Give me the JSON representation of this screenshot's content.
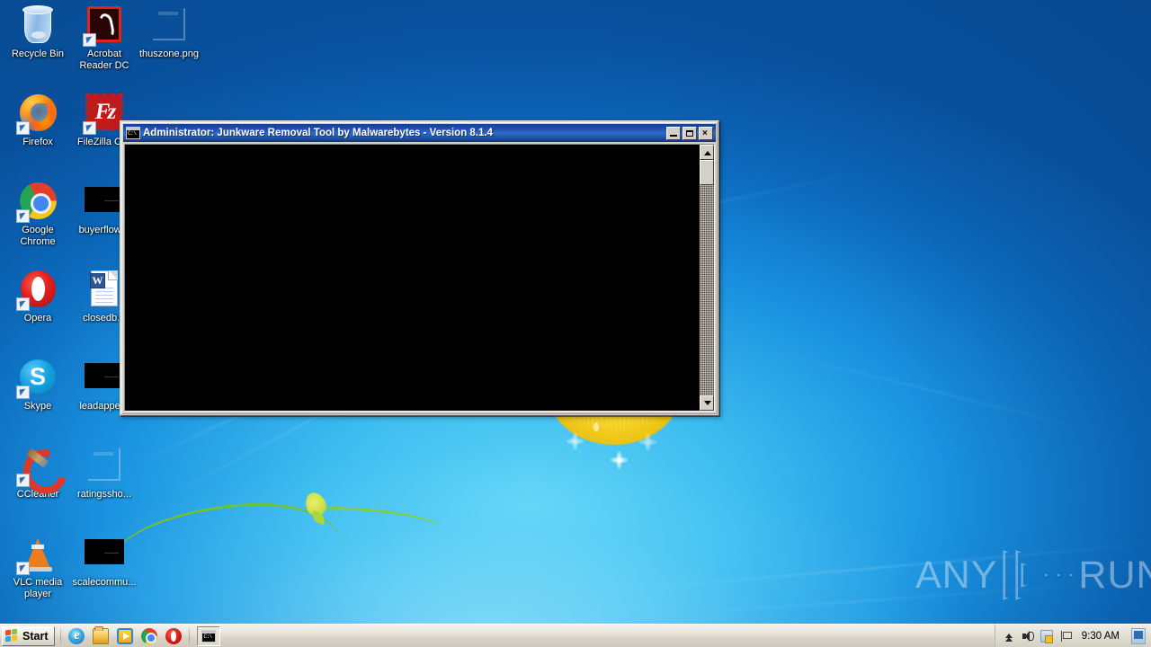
{
  "window": {
    "title": "Administrator:  Junkware Removal Tool by Malwarebytes - Version 8.1.4",
    "icon_name": "cmd-console-icon",
    "icon_text": "C:\\",
    "console_output": "",
    "minimize_label": "",
    "maximize_label": "",
    "close_label": "×"
  },
  "desktop": {
    "icons": [
      {
        "label": "Recycle Bin",
        "art": "recycle",
        "shortcut": false,
        "col": 0,
        "row": 0
      },
      {
        "label": "Acrobat\nReader DC",
        "art": "acrobat",
        "shortcut": true,
        "col": 1,
        "row": 0
      },
      {
        "label": "thuszone.png",
        "art": "ghost",
        "shortcut": false,
        "col": 2,
        "row": 0
      },
      {
        "label": "Firefox",
        "art": "firefox",
        "shortcut": true,
        "col": 0,
        "row": 1
      },
      {
        "label": "FileZilla Clie",
        "art": "filezilla",
        "shortcut": true,
        "col": 1,
        "row": 1
      },
      {
        "label": "Google\nChrome",
        "art": "chrome",
        "shortcut": true,
        "col": 0,
        "row": 2
      },
      {
        "label": "buyerflower",
        "art": "blackthumb",
        "shortcut": false,
        "col": 1,
        "row": 2
      },
      {
        "label": "Opera",
        "art": "opera",
        "shortcut": true,
        "col": 0,
        "row": 3
      },
      {
        "label": "closedb.rt",
        "art": "doc",
        "shortcut": false,
        "col": 1,
        "row": 3
      },
      {
        "label": "Skype",
        "art": "skype",
        "shortcut": true,
        "col": 0,
        "row": 4
      },
      {
        "label": "leadappear",
        "art": "blackthumb",
        "shortcut": false,
        "col": 1,
        "row": 4
      },
      {
        "label": "CCleaner",
        "art": "ccleaner",
        "shortcut": true,
        "col": 0,
        "row": 5
      },
      {
        "label": "ratingssho...",
        "art": "ghost",
        "shortcut": false,
        "col": 1,
        "row": 5
      },
      {
        "label": "VLC media\nplayer",
        "art": "vlc",
        "shortcut": true,
        "col": 0,
        "row": 6
      },
      {
        "label": "scalecommu...",
        "art": "blackthumb",
        "shortcut": false,
        "col": 1,
        "row": 6
      }
    ]
  },
  "taskbar": {
    "start_label": "Start",
    "quick_launch": [
      {
        "name": "internet-explorer-icon",
        "class": "qi-ie"
      },
      {
        "name": "windows-explorer-icon",
        "class": "qi-explorer"
      },
      {
        "name": "windows-media-player-icon",
        "class": "qi-wmp"
      },
      {
        "name": "google-chrome-icon",
        "class": "qi-chrome2"
      },
      {
        "name": "opera-icon",
        "class": "qi-opera2"
      }
    ],
    "running_tasks": [
      {
        "name": "cmd-task-button",
        "icon_text": "C:\\"
      }
    ],
    "tray": {
      "show_hidden_icons": "show-hidden-icons-chevron",
      "volume": "speaker-icon",
      "action_center": "action-center-shield-icon",
      "network": "network-flag-icon",
      "clock": "9:30 AM",
      "show_desktop": "show-desktop-button"
    }
  },
  "watermark": {
    "left_text": "ANY",
    "right_text": "RUN",
    "logo_name": "anyrun-play-logo"
  }
}
